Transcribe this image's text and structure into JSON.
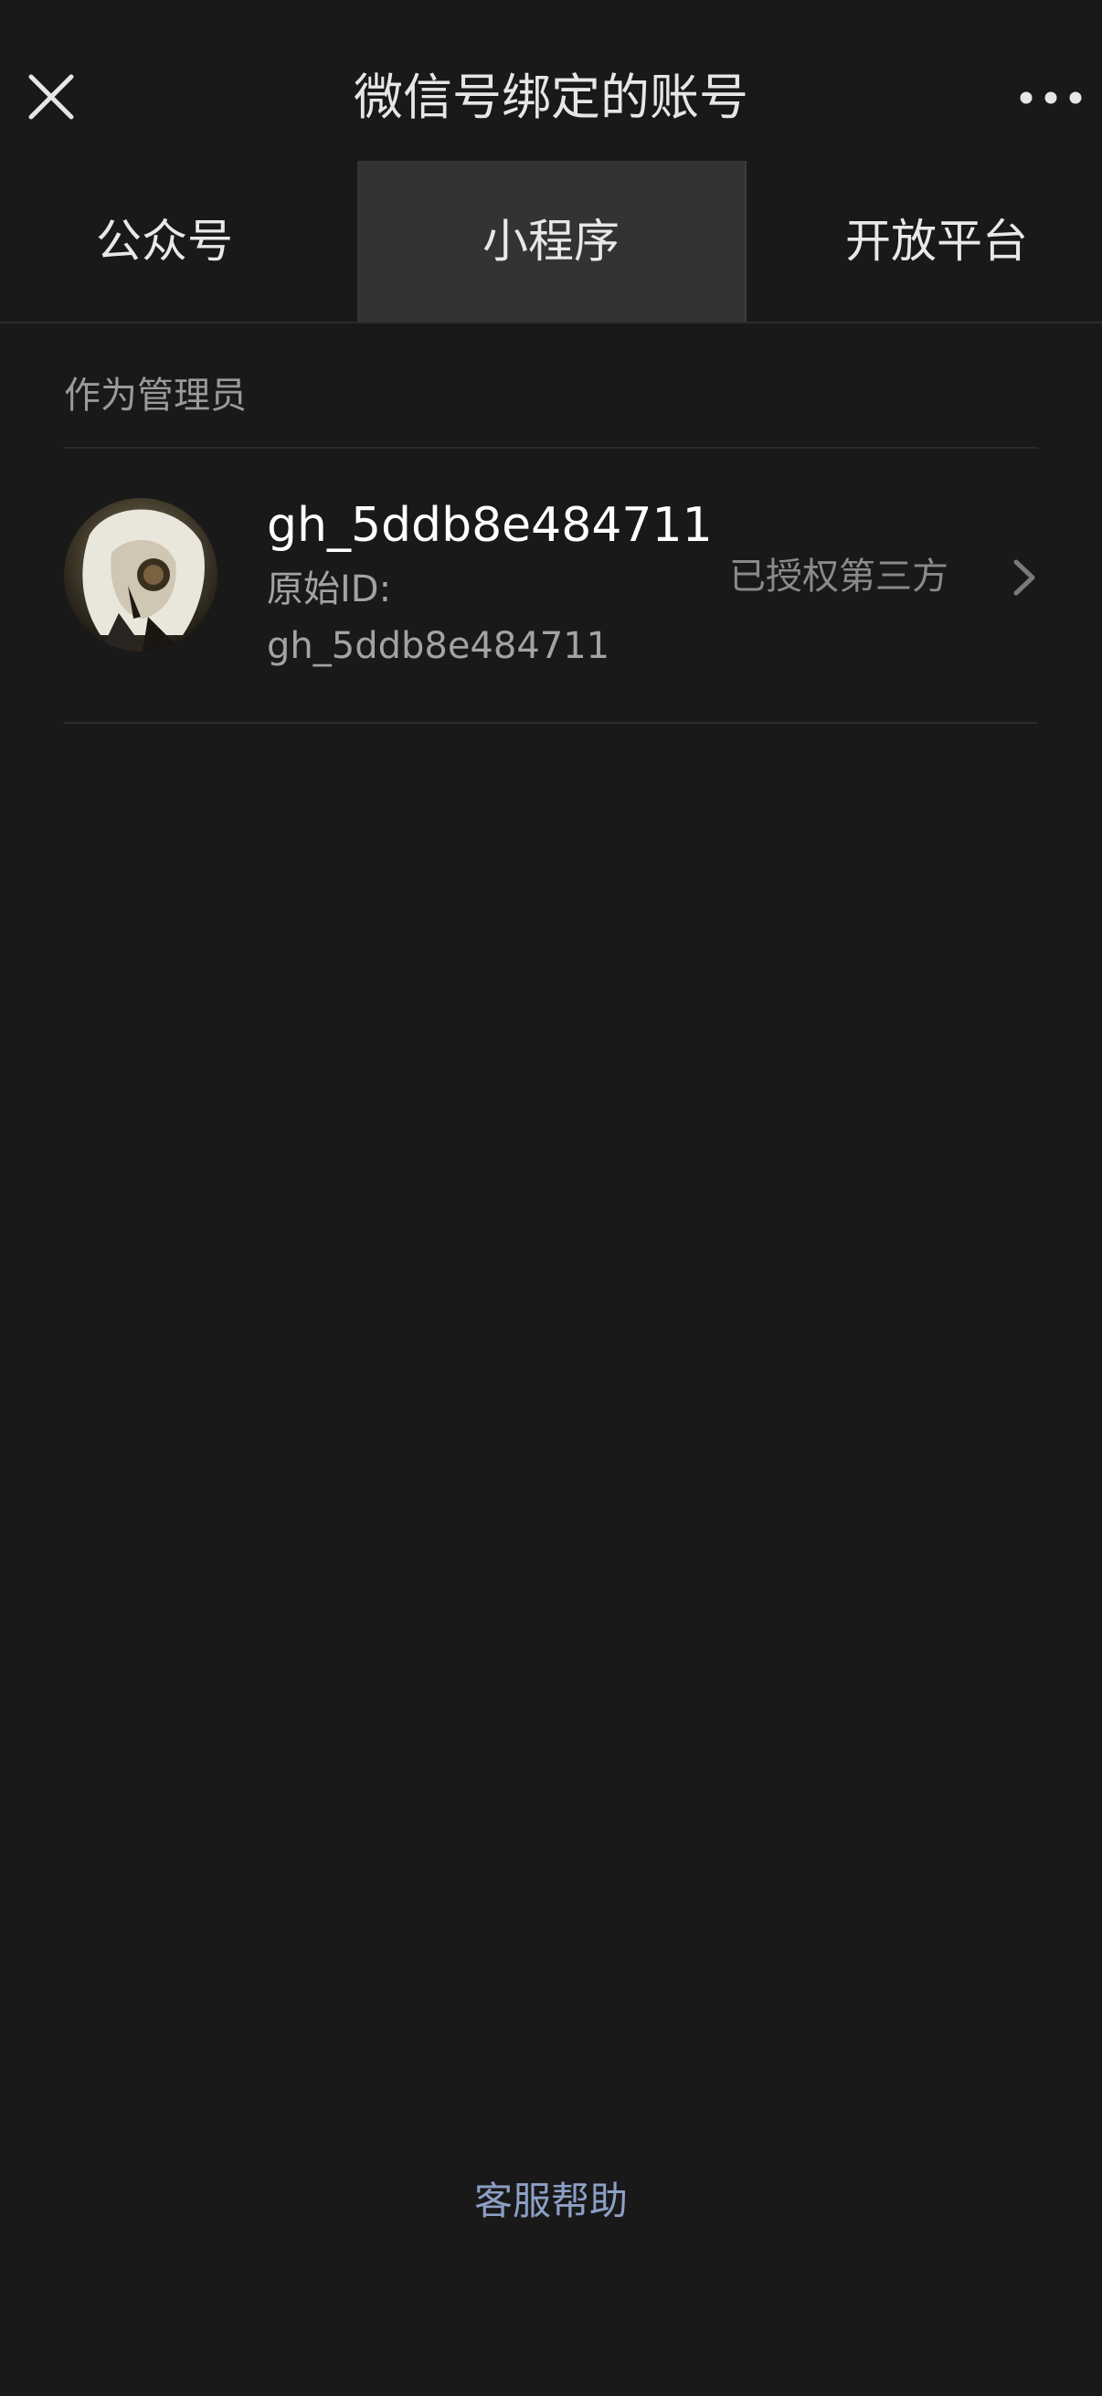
{
  "header": {
    "title": "微信号绑定的账号",
    "close_icon": "close-icon",
    "more_icon": "more-icon"
  },
  "tabs": [
    {
      "label": "公众号",
      "selected": false
    },
    {
      "label": "小程序",
      "selected": true
    },
    {
      "label": "开放平台",
      "selected": false
    }
  ],
  "section": {
    "label": "作为管理员"
  },
  "account": {
    "name": "gh_5ddb8e484711",
    "original_id_label": "原始ID:",
    "original_id_value": "gh_5ddb8e484711",
    "status": "已授权第三方",
    "avatar_icon": "avatar-portrait",
    "chevron_icon": "chevron-right-icon"
  },
  "footer": {
    "help_label": "客服帮助"
  },
  "colors": {
    "background": "#191919",
    "tab_selected_bg": "#333333",
    "link": "#8d9fc6",
    "secondary_text": "#a3a3a3"
  }
}
